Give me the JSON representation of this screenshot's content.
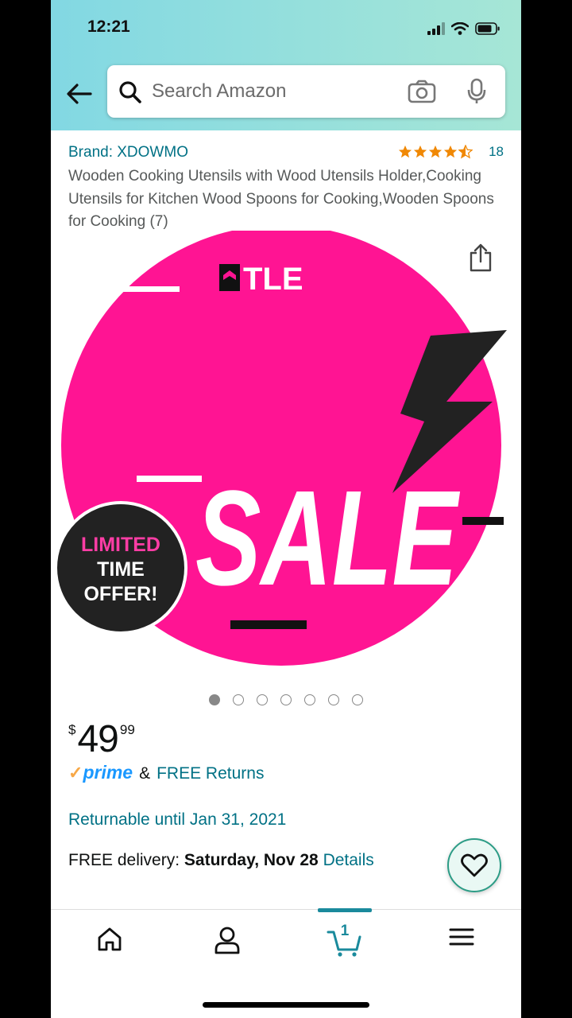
{
  "status_bar": {
    "time": "12:21"
  },
  "search": {
    "placeholder": "Search Amazon"
  },
  "product": {
    "brand": "Brand: XDOWMO",
    "rating_stars": 4.5,
    "rating_count": "18",
    "title": "Wooden Cooking Utensils with Wood Utensils Holder,Cooking Utensils for Kitchen Wood Spoons for Cooking,Wooden Spoons for Cooking (7)",
    "image": {
      "logo_text": "TLE",
      "sale_text": "SALE",
      "badge_line1": "LIMITED",
      "badge_line2": "TIME",
      "badge_line3": "OFFER!"
    },
    "carousel": {
      "count": 7,
      "active_index": 0
    },
    "price": {
      "currency": "$",
      "whole": "49",
      "fraction": "99"
    },
    "prime_label": "prime",
    "prime_amp": "&",
    "free_returns": "FREE Returns",
    "returnable": "Returnable until Jan 31, 2021",
    "delivery_label": "FREE delivery:",
    "delivery_date": "Saturday, Nov 28",
    "delivery_details": "Details"
  },
  "bottom_nav": {
    "cart_count": "1"
  },
  "icons": {
    "back": "arrow-left-icon",
    "search": "search-icon",
    "camera": "camera-icon",
    "mic": "mic-icon",
    "share": "share-icon",
    "wishlist": "heart-icon",
    "home": "home-icon",
    "account": "person-icon",
    "cart": "cart-icon",
    "menu": "hamburger-menu-icon"
  },
  "colors": {
    "link": "#007185",
    "star": "#f08804",
    "prime_blue": "#1a98ff",
    "sale_pink": "#ff1493",
    "header_gradient_start": "#82d8e3",
    "header_gradient_end": "#a6e6d6"
  }
}
